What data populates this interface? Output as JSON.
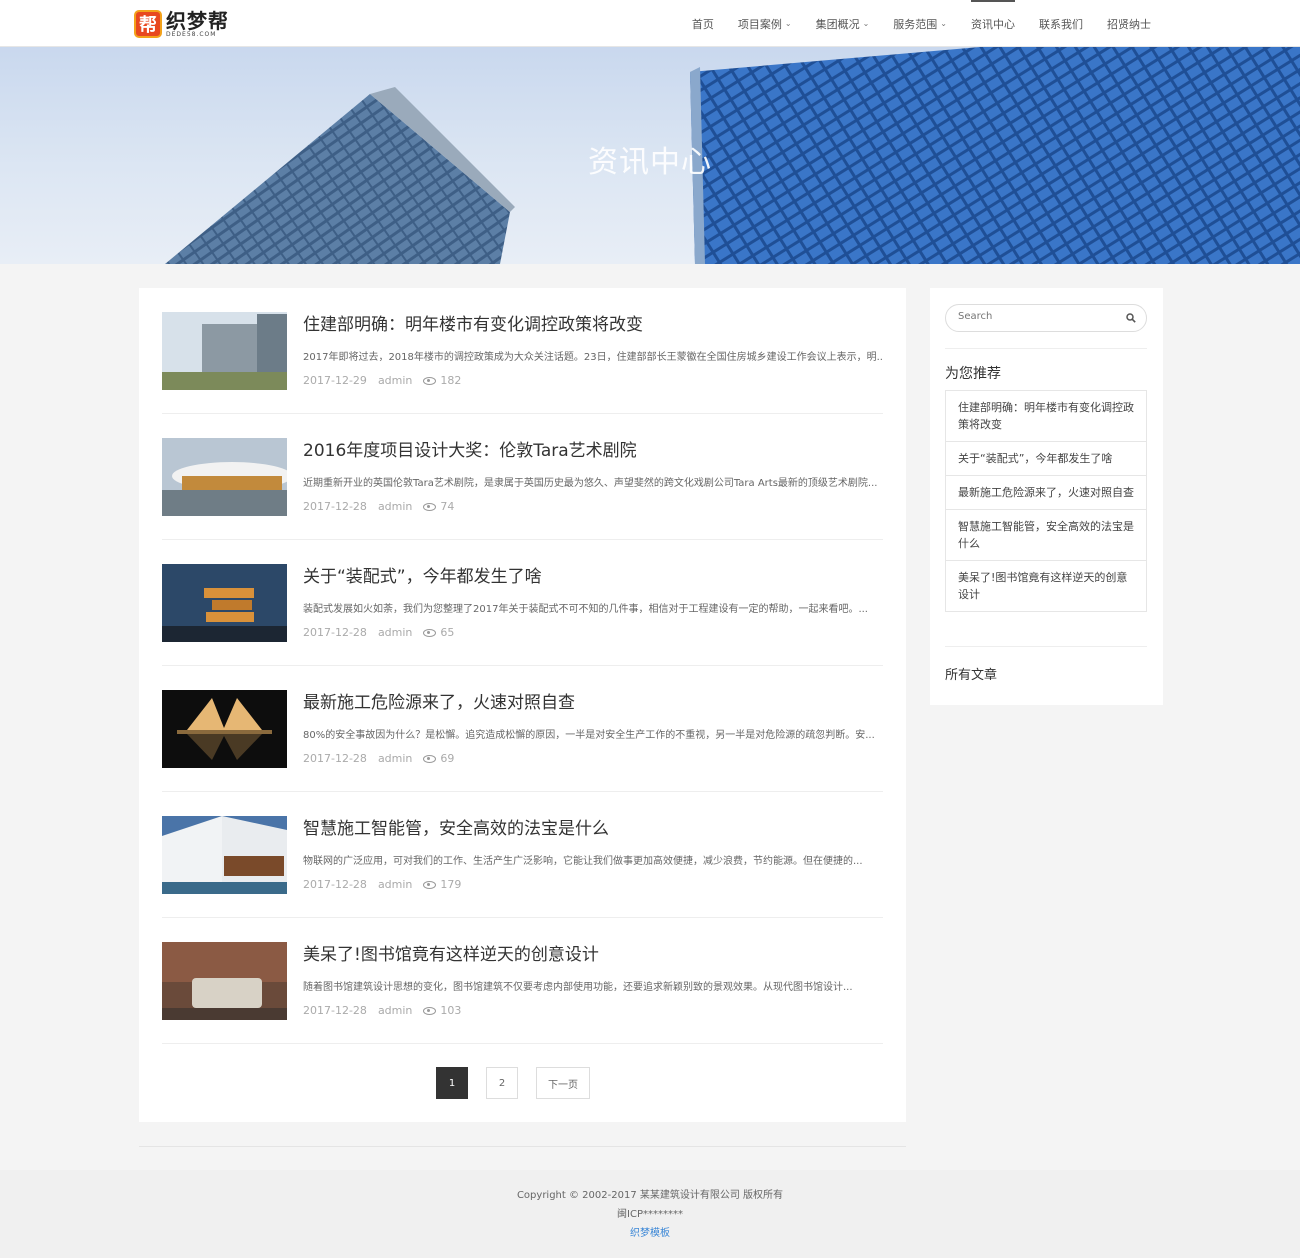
{
  "logo": {
    "mark": "帮",
    "name": "织梦帮",
    "sub": "DEDE58.COM"
  },
  "nav": [
    {
      "label": "首页",
      "dropdown": false,
      "active": false
    },
    {
      "label": "项目案例",
      "dropdown": true,
      "active": false
    },
    {
      "label": "集团概况",
      "dropdown": true,
      "active": false
    },
    {
      "label": "服务范围",
      "dropdown": true,
      "active": false
    },
    {
      "label": "资讯中心",
      "dropdown": false,
      "active": true
    },
    {
      "label": "联系我们",
      "dropdown": false,
      "active": false
    },
    {
      "label": "招贤纳士",
      "dropdown": false,
      "active": false
    }
  ],
  "banner": {
    "title": "资讯中心"
  },
  "articles": [
    {
      "title": "住建部明确：明年楼市有变化调控政策将改变",
      "desc": "2017年即将过去，2018年楼市的调控政策成为大众关注话题。23日，住建部部长王蒙徽在全国住房城乡建设工作会议上表示，明...",
      "date": "2017-12-29",
      "author": "admin",
      "views": "182"
    },
    {
      "title": "2016年度项目设计大奖：伦敦Tara艺术剧院",
      "desc": "近期重新开业的英国伦敦Tara艺术剧院，是隶属于英国历史最为悠久、声望斐然的跨文化戏剧公司Tara Arts最新的顶级艺术剧院...",
      "date": "2017-12-28",
      "author": "admin",
      "views": "74"
    },
    {
      "title": "关于“装配式”，今年都发生了啥",
      "desc": "装配式发展如火如荼，我们为您整理了2017年关于装配式不可不知的几件事，相信对于工程建设有一定的帮助，一起来看吧。...",
      "date": "2017-12-28",
      "author": "admin",
      "views": "65"
    },
    {
      "title": "最新施工危险源来了，火速对照自查",
      "desc": "80%的安全事故因为什么？是松懈。追究造成松懈的原因，一半是对安全生产工作的不重视，另一半是对危险源的疏忽判断。安...",
      "date": "2017-12-28",
      "author": "admin",
      "views": "69"
    },
    {
      "title": "智慧施工智能管，安全高效的法宝是什么",
      "desc": "物联网的广泛应用，可对我们的工作、生活产生广泛影响，它能让我们做事更加高效便捷，减少浪费，节约能源。但在便捷的...",
      "date": "2017-12-28",
      "author": "admin",
      "views": "179"
    },
    {
      "title": "美呆了!图书馆竟有这样逆天的创意设计",
      "desc": "随着图书馆建筑设计思想的变化，图书馆建筑不仅要考虑内部使用功能，还要追求新颖别致的景观效果。从现代图书馆设计...",
      "date": "2017-12-28",
      "author": "admin",
      "views": "103"
    }
  ],
  "pager": {
    "page1": "1",
    "page2": "2",
    "next": "下一页"
  },
  "sidebar": {
    "search_placeholder": "Search",
    "recommend_title": "为您推荐",
    "recommend": [
      "住建部明确：明年楼市有变化调控政策将改变",
      "关于“装配式”，今年都发生了啥",
      "最新施工危险源来了，火速对照自查",
      "智慧施工智能管，安全高效的法宝是什么",
      "美呆了!图书馆竟有这样逆天的创意设计"
    ],
    "all_articles": "所有文章"
  },
  "footer": {
    "copyright": "Copyright © 2002-2017 某某建筑设计有限公司 版权所有",
    "icp": "闽ICP********",
    "template_link": "织梦模板"
  }
}
